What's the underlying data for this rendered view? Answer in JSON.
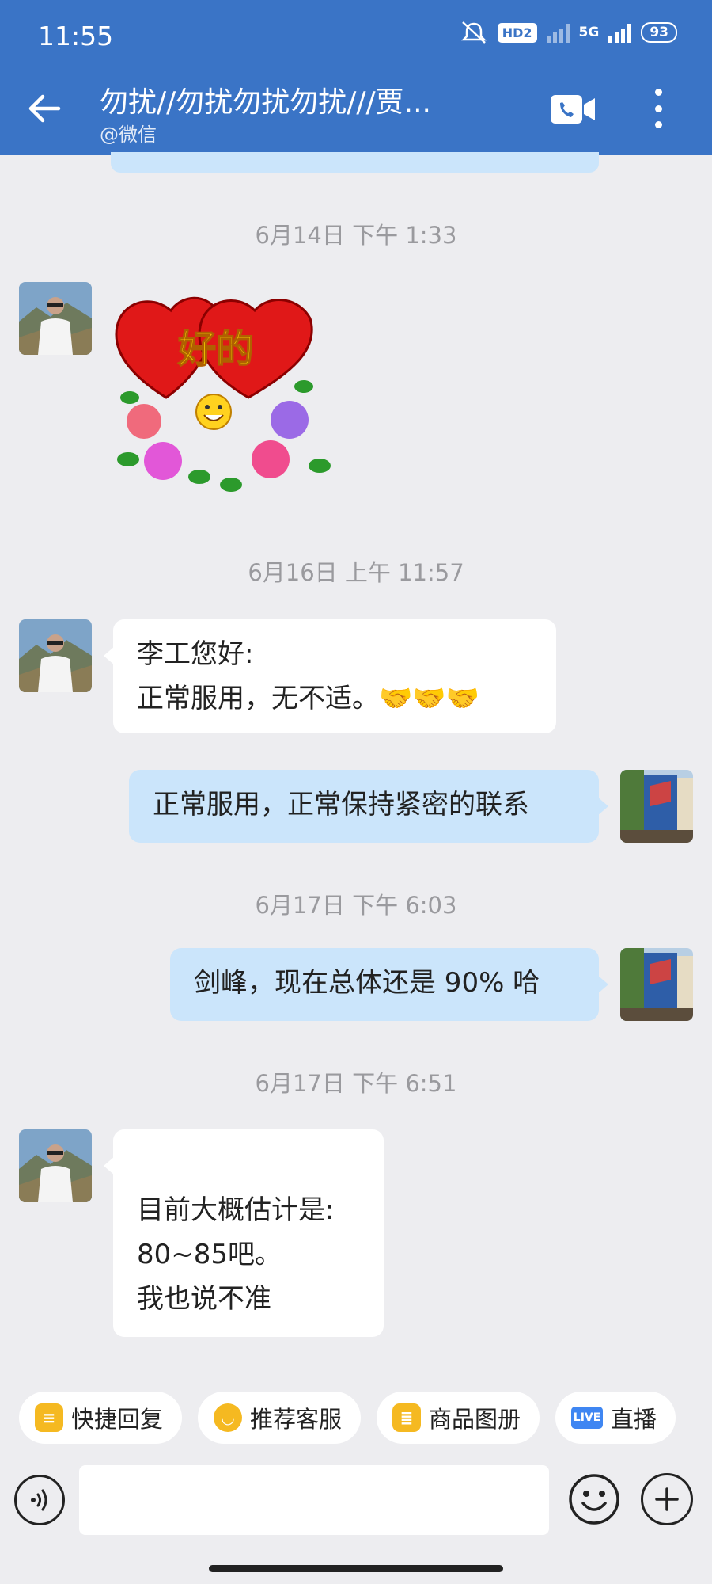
{
  "status_bar": {
    "time": "11:55",
    "hd_label": "HD2",
    "network": "5G",
    "battery": "93"
  },
  "header": {
    "title": "勿扰//勿扰勿扰勿扰///贾...",
    "subtitle": "@微信"
  },
  "messages": [
    {
      "timestamp": "6月14日  下午 1:33",
      "sticker_text": "好的"
    },
    {
      "timestamp": "6月16日  上午 11:57",
      "line1": "李工您好:",
      "line2": "正常服用，无不适。",
      "emoji": "🤝🤝🤝"
    },
    {
      "text": "正常服用，正常保持紧密的联系"
    },
    {
      "timestamp": "6月17日  下午 6:03",
      "text": "剑峰，现在总体还是 90% 哈"
    },
    {
      "timestamp": "6月17日  下午 6:51",
      "line1": "目前大概估计是:",
      "line2": "80~85吧。",
      "line3": "我也说不准"
    }
  ],
  "quick_actions": [
    {
      "label": "快捷回复",
      "icon": "quick-reply-icon"
    },
    {
      "label": "推荐客服",
      "icon": "customer-service-icon"
    },
    {
      "label": "商品图册",
      "icon": "product-album-icon"
    },
    {
      "label": "直播",
      "icon": "live-icon",
      "badge": "LIVE"
    }
  ],
  "input": {
    "placeholder": ""
  },
  "colors": {
    "header": "#3a74c6",
    "my_bubble": "#cbe5fb",
    "background": "#ededf0"
  }
}
